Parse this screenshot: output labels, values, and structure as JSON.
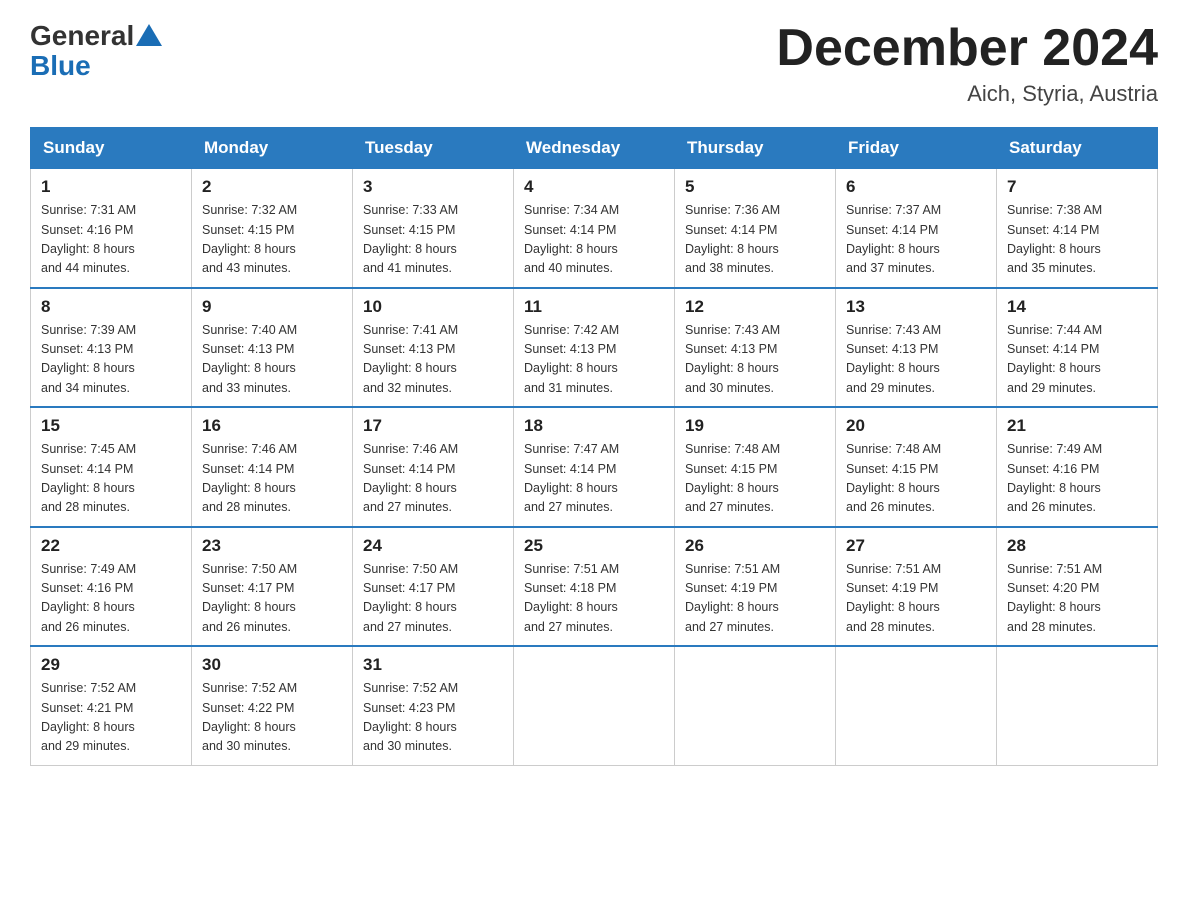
{
  "header": {
    "logo_general": "General",
    "logo_blue": "Blue",
    "month_title": "December 2024",
    "location": "Aich, Styria, Austria"
  },
  "days_of_week": [
    "Sunday",
    "Monday",
    "Tuesday",
    "Wednesday",
    "Thursday",
    "Friday",
    "Saturday"
  ],
  "weeks": [
    [
      {
        "day": "1",
        "sunrise": "7:31 AM",
        "sunset": "4:16 PM",
        "daylight": "8 hours and 44 minutes."
      },
      {
        "day": "2",
        "sunrise": "7:32 AM",
        "sunset": "4:15 PM",
        "daylight": "8 hours and 43 minutes."
      },
      {
        "day": "3",
        "sunrise": "7:33 AM",
        "sunset": "4:15 PM",
        "daylight": "8 hours and 41 minutes."
      },
      {
        "day": "4",
        "sunrise": "7:34 AM",
        "sunset": "4:14 PM",
        "daylight": "8 hours and 40 minutes."
      },
      {
        "day": "5",
        "sunrise": "7:36 AM",
        "sunset": "4:14 PM",
        "daylight": "8 hours and 38 minutes."
      },
      {
        "day": "6",
        "sunrise": "7:37 AM",
        "sunset": "4:14 PM",
        "daylight": "8 hours and 37 minutes."
      },
      {
        "day": "7",
        "sunrise": "7:38 AM",
        "sunset": "4:14 PM",
        "daylight": "8 hours and 35 minutes."
      }
    ],
    [
      {
        "day": "8",
        "sunrise": "7:39 AM",
        "sunset": "4:13 PM",
        "daylight": "8 hours and 34 minutes."
      },
      {
        "day": "9",
        "sunrise": "7:40 AM",
        "sunset": "4:13 PM",
        "daylight": "8 hours and 33 minutes."
      },
      {
        "day": "10",
        "sunrise": "7:41 AM",
        "sunset": "4:13 PM",
        "daylight": "8 hours and 32 minutes."
      },
      {
        "day": "11",
        "sunrise": "7:42 AM",
        "sunset": "4:13 PM",
        "daylight": "8 hours and 31 minutes."
      },
      {
        "day": "12",
        "sunrise": "7:43 AM",
        "sunset": "4:13 PM",
        "daylight": "8 hours and 30 minutes."
      },
      {
        "day": "13",
        "sunrise": "7:43 AM",
        "sunset": "4:13 PM",
        "daylight": "8 hours and 29 minutes."
      },
      {
        "day": "14",
        "sunrise": "7:44 AM",
        "sunset": "4:14 PM",
        "daylight": "8 hours and 29 minutes."
      }
    ],
    [
      {
        "day": "15",
        "sunrise": "7:45 AM",
        "sunset": "4:14 PM",
        "daylight": "8 hours and 28 minutes."
      },
      {
        "day": "16",
        "sunrise": "7:46 AM",
        "sunset": "4:14 PM",
        "daylight": "8 hours and 28 minutes."
      },
      {
        "day": "17",
        "sunrise": "7:46 AM",
        "sunset": "4:14 PM",
        "daylight": "8 hours and 27 minutes."
      },
      {
        "day": "18",
        "sunrise": "7:47 AM",
        "sunset": "4:14 PM",
        "daylight": "8 hours and 27 minutes."
      },
      {
        "day": "19",
        "sunrise": "7:48 AM",
        "sunset": "4:15 PM",
        "daylight": "8 hours and 27 minutes."
      },
      {
        "day": "20",
        "sunrise": "7:48 AM",
        "sunset": "4:15 PM",
        "daylight": "8 hours and 26 minutes."
      },
      {
        "day": "21",
        "sunrise": "7:49 AM",
        "sunset": "4:16 PM",
        "daylight": "8 hours and 26 minutes."
      }
    ],
    [
      {
        "day": "22",
        "sunrise": "7:49 AM",
        "sunset": "4:16 PM",
        "daylight": "8 hours and 26 minutes."
      },
      {
        "day": "23",
        "sunrise": "7:50 AM",
        "sunset": "4:17 PM",
        "daylight": "8 hours and 26 minutes."
      },
      {
        "day": "24",
        "sunrise": "7:50 AM",
        "sunset": "4:17 PM",
        "daylight": "8 hours and 27 minutes."
      },
      {
        "day": "25",
        "sunrise": "7:51 AM",
        "sunset": "4:18 PM",
        "daylight": "8 hours and 27 minutes."
      },
      {
        "day": "26",
        "sunrise": "7:51 AM",
        "sunset": "4:19 PM",
        "daylight": "8 hours and 27 minutes."
      },
      {
        "day": "27",
        "sunrise": "7:51 AM",
        "sunset": "4:19 PM",
        "daylight": "8 hours and 28 minutes."
      },
      {
        "day": "28",
        "sunrise": "7:51 AM",
        "sunset": "4:20 PM",
        "daylight": "8 hours and 28 minutes."
      }
    ],
    [
      {
        "day": "29",
        "sunrise": "7:52 AM",
        "sunset": "4:21 PM",
        "daylight": "8 hours and 29 minutes."
      },
      {
        "day": "30",
        "sunrise": "7:52 AM",
        "sunset": "4:22 PM",
        "daylight": "8 hours and 30 minutes."
      },
      {
        "day": "31",
        "sunrise": "7:52 AM",
        "sunset": "4:23 PM",
        "daylight": "8 hours and 30 minutes."
      },
      null,
      null,
      null,
      null
    ]
  ],
  "labels": {
    "sunrise": "Sunrise:",
    "sunset": "Sunset:",
    "daylight": "Daylight:"
  }
}
